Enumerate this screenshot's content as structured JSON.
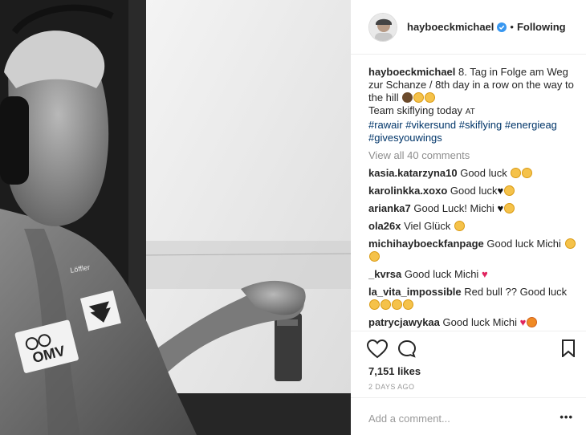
{
  "post": {
    "username": "hayboeckmichael",
    "separator": "•",
    "follow_status": "Following",
    "caption": {
      "user": "hayboeckmichael",
      "text": "8. Tag in Folge am Weg zur Schanze / 8th day in a row on the way to the hill",
      "line2": "Team skiflying today",
      "line2_suffix": "AT",
      "hashtags": [
        "#rawair",
        "#vikersund",
        "#skiflying",
        "#energieag",
        "#givesyouwings"
      ]
    },
    "view_all": "View all 40 comments",
    "comments": [
      {
        "user": "kasia.katarzyna10",
        "text": "Good luck"
      },
      {
        "user": "karolinkka.xoxo",
        "text": "Good luck"
      },
      {
        "user": "arianka7",
        "text": "Good Luck! Michi"
      },
      {
        "user": "ola26x",
        "text": "Viel Glück"
      },
      {
        "user": "michihayboeckfanpage",
        "text": "Good luck Michi"
      },
      {
        "user": "_kvrsa",
        "text": "Good luck Michi"
      },
      {
        "user": "la_vita_impossible",
        "text": "Red bull ?? Good luck"
      },
      {
        "user": "patrycjawykaa",
        "text": "Good luck Michi"
      }
    ],
    "likes": "7,151 likes",
    "time_ago": "2 DAYS AGO",
    "add_comment_placeholder": "Add a comment...",
    "more": "•••",
    "photo_text": {
      "brand": "Löffler",
      "sponsor": "OMV"
    }
  }
}
